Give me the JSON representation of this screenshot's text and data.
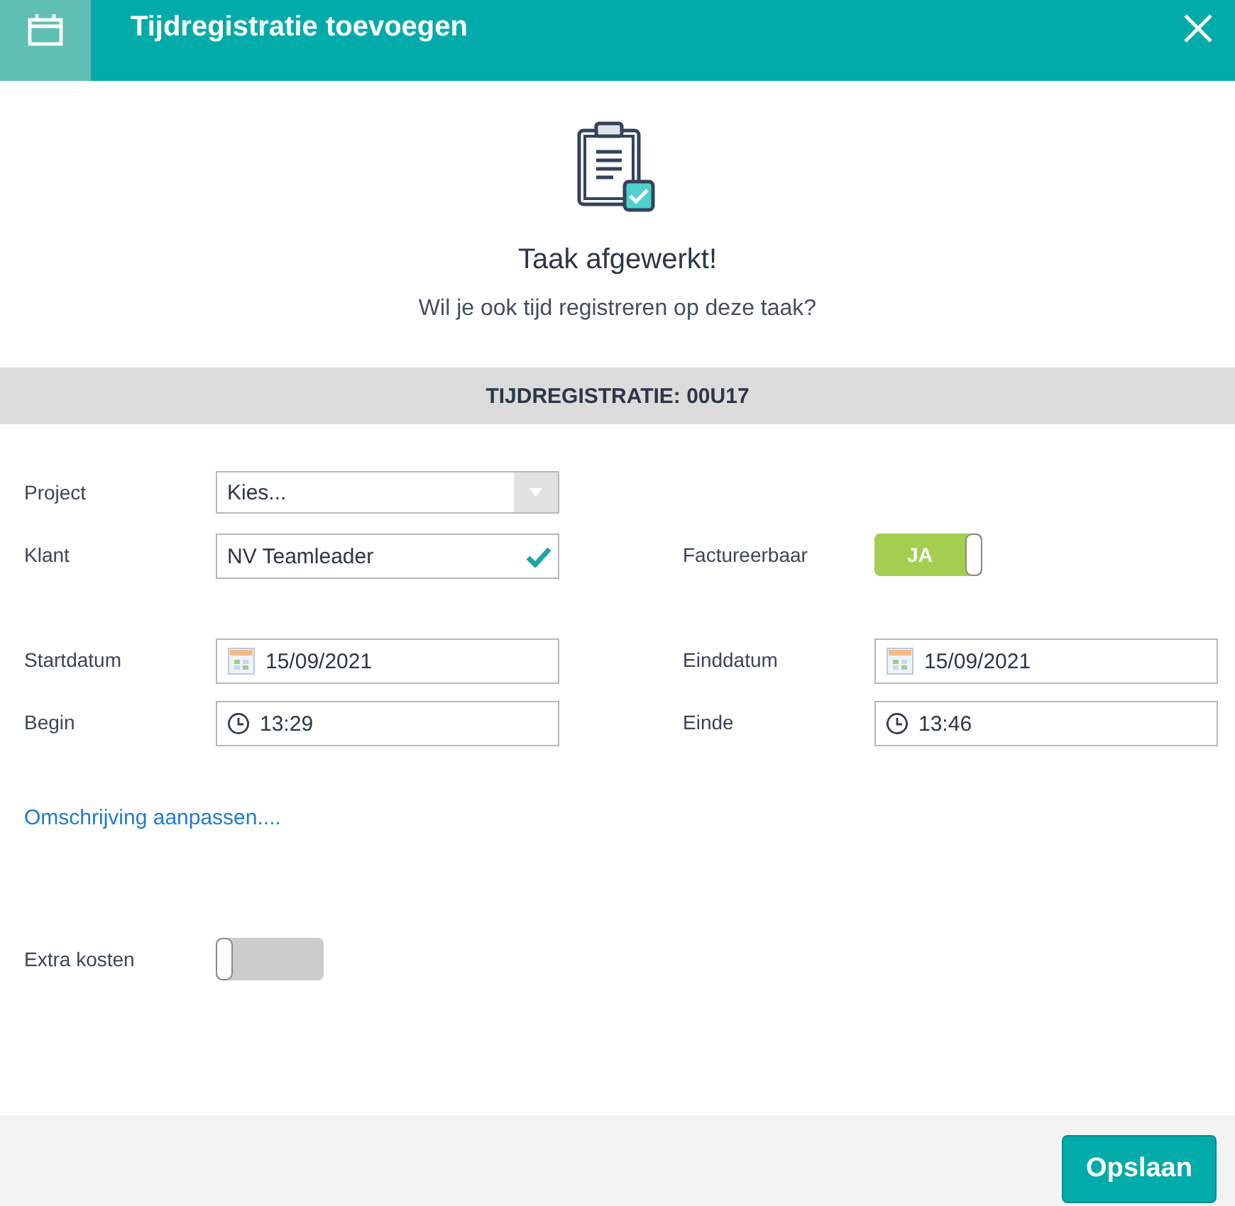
{
  "dialog": {
    "title": "Tijdregistratie toevoegen"
  },
  "message": {
    "heading": "Taak afgewerkt!",
    "text": "Wil je ook tijd registreren op deze taak?"
  },
  "section_header": "TIJDREGISTRATIE: 00U17",
  "field_groups": [
    [
      {
        "cells": [
          {
            "label": "Project",
            "kind": "select",
            "value": "Kies..."
          }
        ]
      },
      {
        "cells": [
          {
            "label": "Klant",
            "kind": "text",
            "value": "NV Teamleader",
            "valid": true
          },
          {
            "label": "Factureerbaar",
            "kind": "toggle",
            "on": true,
            "text": "JA"
          }
        ]
      }
    ],
    [
      {
        "cells": [
          {
            "label": "Startdatum",
            "kind": "date",
            "value": "15/09/2021"
          },
          {
            "label": "Einddatum",
            "kind": "date",
            "value": "15/09/2021"
          }
        ]
      },
      {
        "cells": [
          {
            "label": "Begin",
            "kind": "time",
            "value": "13:29"
          },
          {
            "label": "Einde",
            "kind": "time",
            "value": "13:46"
          }
        ]
      }
    ]
  ],
  "description_link": "Omschrijving aanpassen....",
  "extra_costs": {
    "label": "Extra kosten",
    "on": false
  },
  "buttons": [
    "Opslaan"
  ]
}
